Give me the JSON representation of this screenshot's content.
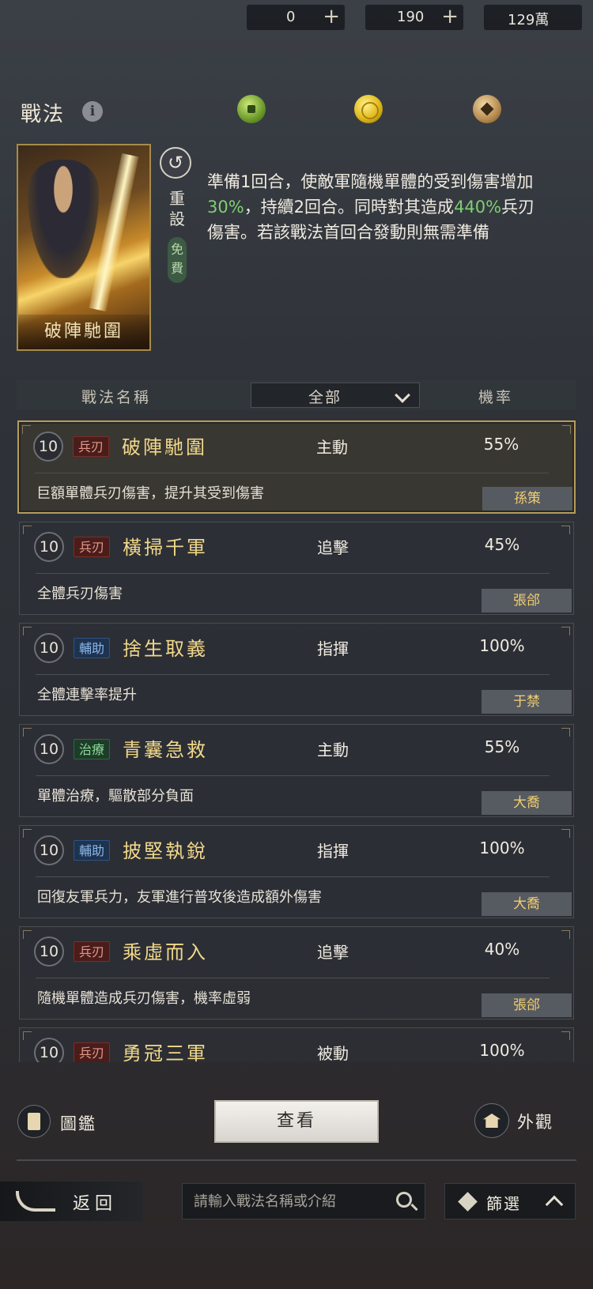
{
  "header": {
    "title": "戰法"
  },
  "resources": [
    {
      "icon": "jade-coin-icon",
      "value": "0"
    },
    {
      "icon": "gold-coin-icon",
      "value": "190"
    },
    {
      "icon": "copper-coin-icon",
      "value": "129萬"
    }
  ],
  "detail": {
    "card_name": "破陣馳圍",
    "reset_label": "重設",
    "free_label": "免費",
    "desc_1": "準備1回合，使敵軍隨機單體的受到傷害增加",
    "desc_hl1": "30%",
    "desc_2": "，持續2回合。同時對其造成",
    "desc_hl2": "440%",
    "desc_3": "兵刃傷害。若該戰法首回合發動則無需準備"
  },
  "table": {
    "col_name": "戰法名稱",
    "filter_value": "全部",
    "col_rate": "機率"
  },
  "skills": [
    {
      "level": "10",
      "tag": "兵刃",
      "tag_type": "blade",
      "name": "破陣馳圍",
      "type": "主動",
      "rate": "55%",
      "desc": "巨額單體兵刃傷害，提升其受到傷害",
      "owner": "孫策"
    },
    {
      "level": "10",
      "tag": "兵刃",
      "tag_type": "blade",
      "name": "橫掃千軍",
      "type": "追擊",
      "rate": "45%",
      "desc": "全體兵刃傷害",
      "owner": "張郃"
    },
    {
      "level": "10",
      "tag": "輔助",
      "tag_type": "aux",
      "name": "捨生取義",
      "type": "指揮",
      "rate": "100%",
      "desc": "全體連擊率提升",
      "owner": "于禁"
    },
    {
      "level": "10",
      "tag": "治療",
      "tag_type": "heal",
      "name": "青囊急救",
      "type": "主動",
      "rate": "55%",
      "desc": "單體治療，驅散部分負面",
      "owner": "大喬"
    },
    {
      "level": "10",
      "tag": "輔助",
      "tag_type": "aux",
      "name": "披堅執銳",
      "type": "指揮",
      "rate": "100%",
      "desc": "回復友軍兵力，友軍進行普攻後造成額外傷害",
      "owner": "大喬"
    },
    {
      "level": "10",
      "tag": "兵刃",
      "tag_type": "blade",
      "name": "乘虛而入",
      "type": "追擊",
      "rate": "40%",
      "desc": "隨機單體造成兵刃傷害，機率虛弱",
      "owner": "張郃"
    },
    {
      "level": "10",
      "tag": "兵刃",
      "tag_type": "blade",
      "name": "勇冠三軍",
      "type": "被動",
      "rate": "100%",
      "desc": "",
      "owner": ""
    }
  ],
  "actions": {
    "atlas_label": "圖鑑",
    "view_label": "查看",
    "skin_label": "外觀"
  },
  "footer": {
    "back_label": "返回",
    "search_placeholder": "請輸入戰法名稱或介紹",
    "filter_label": "篩選"
  }
}
